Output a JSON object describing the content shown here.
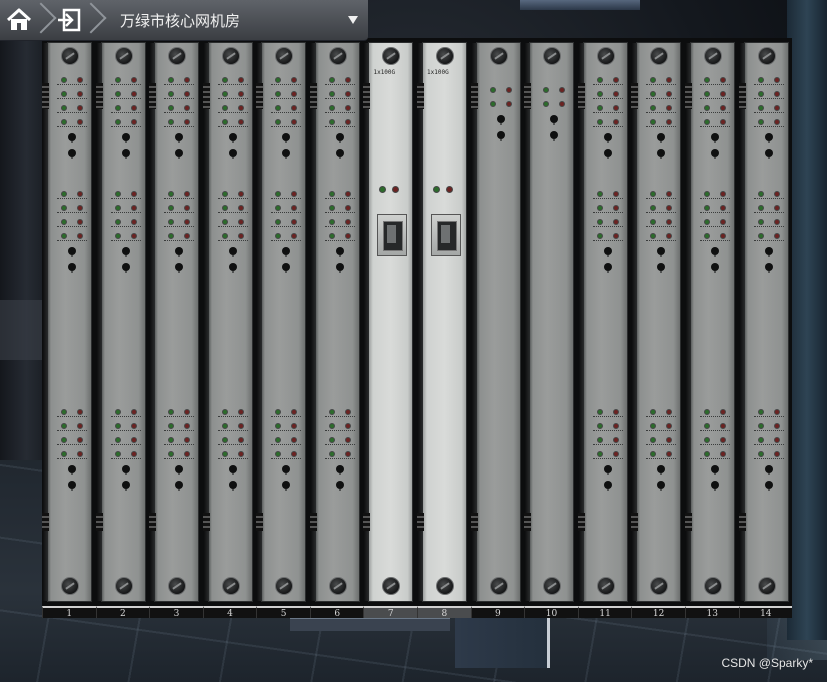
{
  "nav": {
    "title": "万绿市核心网机房",
    "home_icon": "home-icon",
    "back_icon": "exit-icon",
    "dropdown_icon": "caret-down-icon"
  },
  "chassis": {
    "slots": [
      {
        "number": "1",
        "type": "standard"
      },
      {
        "number": "2",
        "type": "standard"
      },
      {
        "number": "3",
        "type": "standard"
      },
      {
        "number": "4",
        "type": "standard"
      },
      {
        "number": "5",
        "type": "standard"
      },
      {
        "number": "6",
        "type": "standard"
      },
      {
        "number": "7",
        "type": "optical",
        "label": "1x100G"
      },
      {
        "number": "8",
        "type": "optical",
        "label": "1x100G"
      },
      {
        "number": "9",
        "type": "control"
      },
      {
        "number": "10",
        "type": "control"
      },
      {
        "number": "11",
        "type": "standard"
      },
      {
        "number": "12",
        "type": "standard"
      },
      {
        "number": "13",
        "type": "standard"
      },
      {
        "number": "14",
        "type": "standard"
      }
    ]
  },
  "watermark": "CSDN @Sparky*"
}
